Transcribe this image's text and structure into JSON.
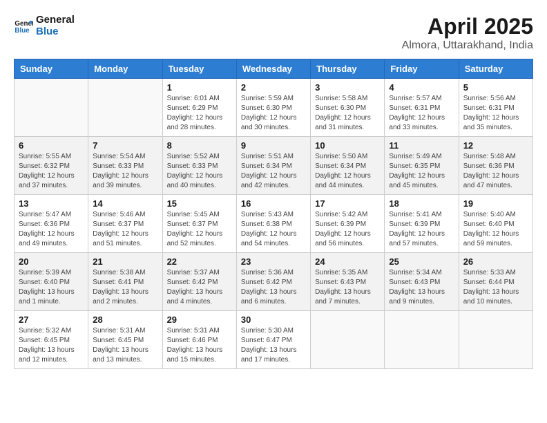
{
  "header": {
    "logo_line1": "General",
    "logo_line2": "Blue",
    "title": "April 2025",
    "subtitle": "Almora, Uttarakhand, India"
  },
  "columns": [
    "Sunday",
    "Monday",
    "Tuesday",
    "Wednesday",
    "Thursday",
    "Friday",
    "Saturday"
  ],
  "weeks": [
    [
      {
        "day": "",
        "info": ""
      },
      {
        "day": "",
        "info": ""
      },
      {
        "day": "1",
        "info": "Sunrise: 6:01 AM\nSunset: 6:29 PM\nDaylight: 12 hours and 28 minutes."
      },
      {
        "day": "2",
        "info": "Sunrise: 5:59 AM\nSunset: 6:30 PM\nDaylight: 12 hours and 30 minutes."
      },
      {
        "day": "3",
        "info": "Sunrise: 5:58 AM\nSunset: 6:30 PM\nDaylight: 12 hours and 31 minutes."
      },
      {
        "day": "4",
        "info": "Sunrise: 5:57 AM\nSunset: 6:31 PM\nDaylight: 12 hours and 33 minutes."
      },
      {
        "day": "5",
        "info": "Sunrise: 5:56 AM\nSunset: 6:31 PM\nDaylight: 12 hours and 35 minutes."
      }
    ],
    [
      {
        "day": "6",
        "info": "Sunrise: 5:55 AM\nSunset: 6:32 PM\nDaylight: 12 hours and 37 minutes."
      },
      {
        "day": "7",
        "info": "Sunrise: 5:54 AM\nSunset: 6:33 PM\nDaylight: 12 hours and 39 minutes."
      },
      {
        "day": "8",
        "info": "Sunrise: 5:52 AM\nSunset: 6:33 PM\nDaylight: 12 hours and 40 minutes."
      },
      {
        "day": "9",
        "info": "Sunrise: 5:51 AM\nSunset: 6:34 PM\nDaylight: 12 hours and 42 minutes."
      },
      {
        "day": "10",
        "info": "Sunrise: 5:50 AM\nSunset: 6:34 PM\nDaylight: 12 hours and 44 minutes."
      },
      {
        "day": "11",
        "info": "Sunrise: 5:49 AM\nSunset: 6:35 PM\nDaylight: 12 hours and 45 minutes."
      },
      {
        "day": "12",
        "info": "Sunrise: 5:48 AM\nSunset: 6:36 PM\nDaylight: 12 hours and 47 minutes."
      }
    ],
    [
      {
        "day": "13",
        "info": "Sunrise: 5:47 AM\nSunset: 6:36 PM\nDaylight: 12 hours and 49 minutes."
      },
      {
        "day": "14",
        "info": "Sunrise: 5:46 AM\nSunset: 6:37 PM\nDaylight: 12 hours and 51 minutes."
      },
      {
        "day": "15",
        "info": "Sunrise: 5:45 AM\nSunset: 6:37 PM\nDaylight: 12 hours and 52 minutes."
      },
      {
        "day": "16",
        "info": "Sunrise: 5:43 AM\nSunset: 6:38 PM\nDaylight: 12 hours and 54 minutes."
      },
      {
        "day": "17",
        "info": "Sunrise: 5:42 AM\nSunset: 6:39 PM\nDaylight: 12 hours and 56 minutes."
      },
      {
        "day": "18",
        "info": "Sunrise: 5:41 AM\nSunset: 6:39 PM\nDaylight: 12 hours and 57 minutes."
      },
      {
        "day": "19",
        "info": "Sunrise: 5:40 AM\nSunset: 6:40 PM\nDaylight: 12 hours and 59 minutes."
      }
    ],
    [
      {
        "day": "20",
        "info": "Sunrise: 5:39 AM\nSunset: 6:40 PM\nDaylight: 13 hours and 1 minute."
      },
      {
        "day": "21",
        "info": "Sunrise: 5:38 AM\nSunset: 6:41 PM\nDaylight: 13 hours and 2 minutes."
      },
      {
        "day": "22",
        "info": "Sunrise: 5:37 AM\nSunset: 6:42 PM\nDaylight: 13 hours and 4 minutes."
      },
      {
        "day": "23",
        "info": "Sunrise: 5:36 AM\nSunset: 6:42 PM\nDaylight: 13 hours and 6 minutes."
      },
      {
        "day": "24",
        "info": "Sunrise: 5:35 AM\nSunset: 6:43 PM\nDaylight: 13 hours and 7 minutes."
      },
      {
        "day": "25",
        "info": "Sunrise: 5:34 AM\nSunset: 6:43 PM\nDaylight: 13 hours and 9 minutes."
      },
      {
        "day": "26",
        "info": "Sunrise: 5:33 AM\nSunset: 6:44 PM\nDaylight: 13 hours and 10 minutes."
      }
    ],
    [
      {
        "day": "27",
        "info": "Sunrise: 5:32 AM\nSunset: 6:45 PM\nDaylight: 13 hours and 12 minutes."
      },
      {
        "day": "28",
        "info": "Sunrise: 5:31 AM\nSunset: 6:45 PM\nDaylight: 13 hours and 13 minutes."
      },
      {
        "day": "29",
        "info": "Sunrise: 5:31 AM\nSunset: 6:46 PM\nDaylight: 13 hours and 15 minutes."
      },
      {
        "day": "30",
        "info": "Sunrise: 5:30 AM\nSunset: 6:47 PM\nDaylight: 13 hours and 17 minutes."
      },
      {
        "day": "",
        "info": ""
      },
      {
        "day": "",
        "info": ""
      },
      {
        "day": "",
        "info": ""
      }
    ]
  ]
}
